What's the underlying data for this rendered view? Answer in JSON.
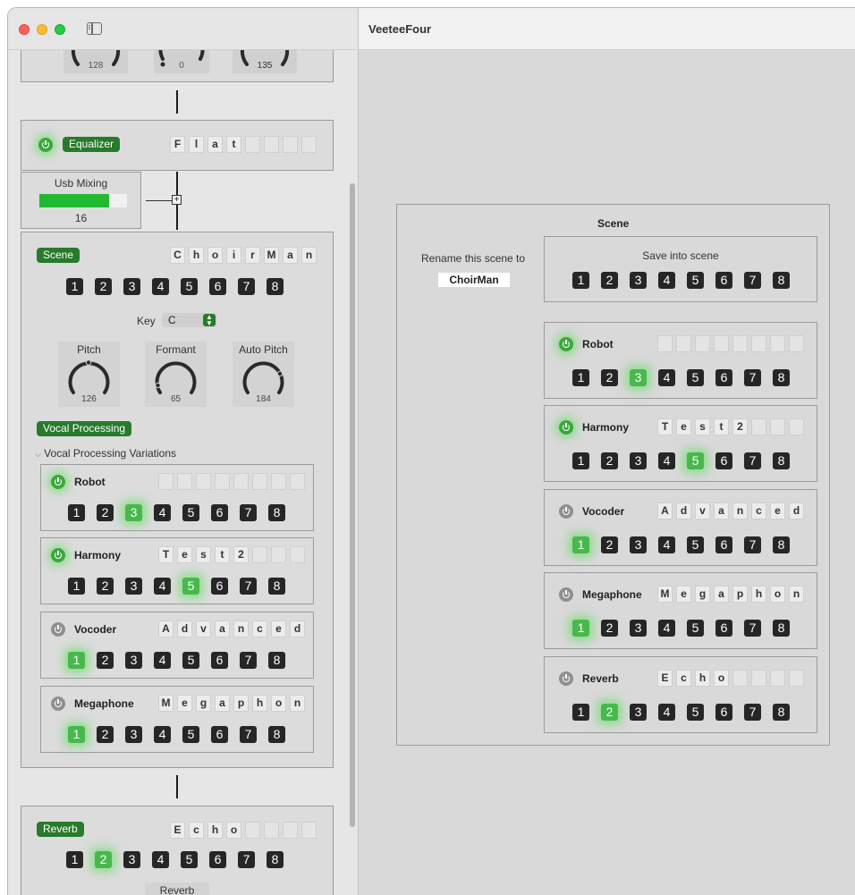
{
  "window": {
    "title": "VeeteeFour"
  },
  "sidebar": {
    "top_knobs": [
      "128",
      "0",
      "135"
    ],
    "equalizer": {
      "label": "Equalizer",
      "letters": [
        "F",
        "l",
        "a",
        "t",
        "",
        "",
        "",
        ""
      ]
    },
    "usb_mixing": {
      "label": "Usb Mixing",
      "value": "16",
      "level_fraction": 0.8
    },
    "scene": {
      "label": "Scene",
      "letters": [
        "C",
        "h",
        "o",
        "i",
        "r",
        "M",
        "a",
        "n"
      ],
      "numbers": [
        "1",
        "2",
        "3",
        "4",
        "5",
        "6",
        "7",
        "8"
      ],
      "key_label": "Key",
      "key_value": "C",
      "knobs": [
        {
          "label": "Pitch",
          "value": "126"
        },
        {
          "label": "Formant",
          "value": "65"
        },
        {
          "label": "Auto Pitch",
          "value": "184"
        }
      ]
    },
    "vocal_processing": {
      "label": "Vocal Processing",
      "disclosure_label": "Vocal Processing Variations",
      "items": [
        {
          "name": "Robot",
          "power": "on",
          "letters": [
            "",
            "",
            "",
            "",
            "",
            "",
            "",
            ""
          ],
          "selected": "3"
        },
        {
          "name": "Harmony",
          "power": "on",
          "letters": [
            "T",
            "e",
            "s",
            "t",
            "2",
            "",
            "",
            ""
          ],
          "selected": "5"
        },
        {
          "name": "Vocoder",
          "power": "off",
          "letters": [
            "A",
            "d",
            "v",
            "a",
            "n",
            "c",
            "e",
            "d"
          ],
          "selected": "1"
        },
        {
          "name": "Megaphone",
          "power": "off",
          "letters": [
            "M",
            "e",
            "g",
            "a",
            "p",
            "h",
            "o",
            "n"
          ],
          "selected": "1"
        }
      ]
    },
    "reverb": {
      "label": "Reverb",
      "letters": [
        "E",
        "c",
        "h",
        "o",
        "",
        "",
        "",
        ""
      ],
      "selected": "2",
      "knob_label": "Reverb"
    }
  },
  "main": {
    "scene_title": "Scene",
    "rename_label": "Rename this scene to",
    "rename_value": "ChoirMan",
    "save_label": "Save into scene",
    "numbers": [
      "1",
      "2",
      "3",
      "4",
      "5",
      "6",
      "7",
      "8"
    ],
    "items": [
      {
        "name": "Robot",
        "power": "on",
        "letters": [
          "",
          "",
          "",
          "",
          "",
          "",
          "",
          ""
        ],
        "selected": "3"
      },
      {
        "name": "Harmony",
        "power": "on",
        "letters": [
          "T",
          "e",
          "s",
          "t",
          "2",
          "",
          "",
          ""
        ],
        "selected": "5"
      },
      {
        "name": "Vocoder",
        "power": "off",
        "letters": [
          "A",
          "d",
          "v",
          "a",
          "n",
          "c",
          "e",
          "d"
        ],
        "selected": "1"
      },
      {
        "name": "Megaphone",
        "power": "off",
        "letters": [
          "M",
          "e",
          "g",
          "a",
          "p",
          "h",
          "o",
          "n"
        ],
        "selected": "1"
      },
      {
        "name": "Reverb",
        "power": "off",
        "letters": [
          "E",
          "c",
          "h",
          "o",
          "",
          "",
          "",
          ""
        ],
        "selected": "2"
      }
    ]
  },
  "colors": {
    "accent_green": "#287a2c",
    "active_green": "#48b84d",
    "button_dark": "#262626"
  }
}
